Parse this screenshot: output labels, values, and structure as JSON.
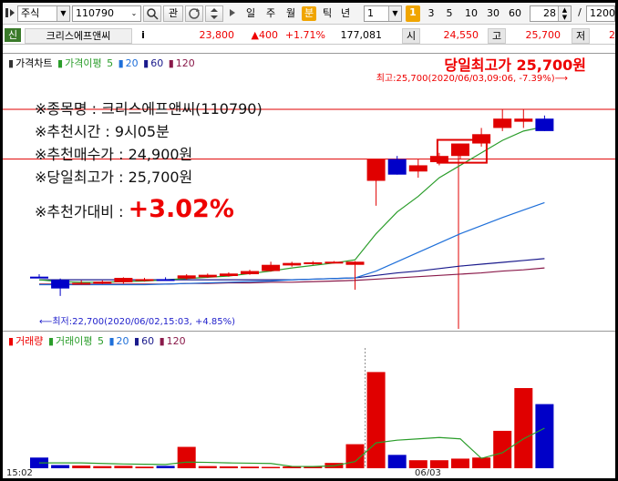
{
  "toolbar": {
    "market": "주식",
    "code": "110790",
    "btn_search_icon": "magnifier-icon",
    "btn_gwan": "관",
    "periods": [
      "일",
      "주",
      "월",
      "분",
      "틱",
      "년"
    ],
    "active_period": "분",
    "unit_value": "1",
    "minutes": [
      "1",
      "3",
      "5",
      "10",
      "30",
      "60"
    ],
    "count": "28",
    "separator": "/",
    "total": "1200"
  },
  "quote": {
    "tag": "신",
    "name": "크리스에프앤씨",
    "info_icon": "i",
    "price": "23,800",
    "change": "▲400",
    "change_pct": "+1.71%",
    "volume": "177,081",
    "open_label": "시",
    "open": "24,550",
    "high_label": "고",
    "high": "25,700",
    "low_label": "저",
    "low": "2"
  },
  "colors": {
    "up": "#e00000",
    "down": "#0000c8",
    "ma5": "#2a9d2a",
    "ma20": "#1e6fd9",
    "ma60": "#1a1a8c",
    "ma120": "#8a1a4a",
    "accent_red": "#e00000"
  },
  "price_legend": {
    "title": "가격차트",
    "ma_label": "가격이평",
    "ma_periods": [
      "5",
      "20",
      "60",
      "120"
    ]
  },
  "volume_legend": {
    "title": "거래량",
    "ma_label": "거래이평",
    "ma_periods": [
      "5",
      "20",
      "60",
      "120"
    ]
  },
  "annotations": {
    "day_high_title": "당일최고가 25,700원",
    "high_marker": "최고:25,700(2020/06/03,09:06, -7.39%)⟶",
    "low_marker": "⟵최저:22,700(2020/06/02,15:03, +4.85%)"
  },
  "info": {
    "name_line": "※종목명 : 크리스에프앤씨(110790)",
    "time_line": "※추천시간 : 9시05분",
    "buy_line": "※추천매수가 : 24,900원",
    "high_line": "※당일최고가 : 25,700원",
    "compare_label": "※추천가대비 :",
    "compare_pct": "+3.02%"
  },
  "x_axis": {
    "labels": [
      "15:02",
      "06/03"
    ]
  },
  "chart_data": {
    "type": "candlestick",
    "price_ylim": [
      22200,
      26300
    ],
    "candles": [
      {
        "o": 23010,
        "h": 23050,
        "l": 22990,
        "c": 23000
      },
      {
        "o": 22960,
        "h": 22980,
        "l": 22700,
        "c": 22820
      },
      {
        "o": 22900,
        "h": 22950,
        "l": 22880,
        "c": 22910
      },
      {
        "o": 22910,
        "h": 22950,
        "l": 22890,
        "c": 22930
      },
      {
        "o": 22920,
        "h": 23000,
        "l": 22900,
        "c": 22990
      },
      {
        "o": 22960,
        "h": 22990,
        "l": 22930,
        "c": 22970
      },
      {
        "o": 22970,
        "h": 23000,
        "l": 22950,
        "c": 22960
      },
      {
        "o": 22980,
        "h": 23050,
        "l": 22960,
        "c": 23030
      },
      {
        "o": 23000,
        "h": 23060,
        "l": 22990,
        "c": 23040
      },
      {
        "o": 23020,
        "h": 23080,
        "l": 23010,
        "c": 23060
      },
      {
        "o": 23050,
        "h": 23120,
        "l": 23040,
        "c": 23100
      },
      {
        "o": 23100,
        "h": 23250,
        "l": 23090,
        "c": 23200
      },
      {
        "o": 23190,
        "h": 23250,
        "l": 23170,
        "c": 23230
      },
      {
        "o": 23230,
        "h": 23260,
        "l": 23200,
        "c": 23240
      },
      {
        "o": 23240,
        "h": 23260,
        "l": 23230,
        "c": 23250
      },
      {
        "o": 23200,
        "h": 23260,
        "l": 22800,
        "c": 23250
      },
      {
        "o": 24550,
        "h": 24900,
        "l": 24150,
        "c": 24900
      },
      {
        "o": 24900,
        "h": 24950,
        "l": 24650,
        "c": 24650
      },
      {
        "o": 24700,
        "h": 24900,
        "l": 24600,
        "c": 24800
      },
      {
        "o": 24850,
        "h": 25000,
        "l": 24800,
        "c": 24950
      },
      {
        "o": 24950,
        "h": 25150,
        "l": 24900,
        "c": 25150
      },
      {
        "o": 25150,
        "h": 25400,
        "l": 25100,
        "c": 25300
      },
      {
        "o": 25400,
        "h": 25700,
        "l": 25350,
        "c": 25550
      },
      {
        "o": 25500,
        "h": 25700,
        "l": 25400,
        "c": 25550
      },
      {
        "o": 25550,
        "h": 25600,
        "l": 25350,
        "c": 25350
      }
    ],
    "ma5": [
      22960,
      22930,
      22920,
      22920,
      22930,
      22940,
      22960,
      22980,
      23000,
      23020,
      23060,
      23100,
      23150,
      23190,
      23230,
      23280,
      23700,
      24050,
      24300,
      24600,
      24800,
      25000,
      25200,
      25350,
      25420
    ],
    "ma20": [
      22880,
      22880,
      22880,
      22880,
      22880,
      22880,
      22890,
      22900,
      22910,
      22920,
      22930,
      22940,
      22960,
      22970,
      22980,
      22990,
      23100,
      23250,
      23400,
      23550,
      23700,
      23830,
      23960,
      24080,
      24200
    ],
    "ma60": [
      22960,
      22960,
      22960,
      22960,
      22960,
      22960,
      22960,
      22960,
      22960,
      22960,
      22960,
      22960,
      22960,
      22970,
      22980,
      22990,
      23030,
      23070,
      23100,
      23140,
      23180,
      23210,
      23240,
      23270,
      23300
    ],
    "ma120": [
      22890,
      22890,
      22890,
      22890,
      22890,
      22890,
      22890,
      22900,
      22900,
      22910,
      22910,
      22920,
      22920,
      22930,
      22940,
      22950,
      22970,
      22990,
      23010,
      23030,
      23050,
      23070,
      23100,
      23120,
      23150
    ],
    "volume_ylim": [
      0,
      45000
    ],
    "volume": [
      4000,
      1200,
      1000,
      800,
      900,
      600,
      900,
      8000,
      800,
      700,
      600,
      500,
      700,
      700,
      2000,
      9000,
      36000,
      5000,
      3000,
      3000,
      3600,
      4000,
      14000,
      30000,
      24000
    ],
    "volume_ma5": [
      2000,
      2000,
      2000,
      1800,
      1600,
      1500,
      1400,
      2300,
      2200,
      2000,
      1900,
      1800,
      700,
      650,
      900,
      2500,
      9500,
      10500,
      11000,
      11500,
      11000,
      3700,
      5800,
      11000,
      15000
    ]
  }
}
